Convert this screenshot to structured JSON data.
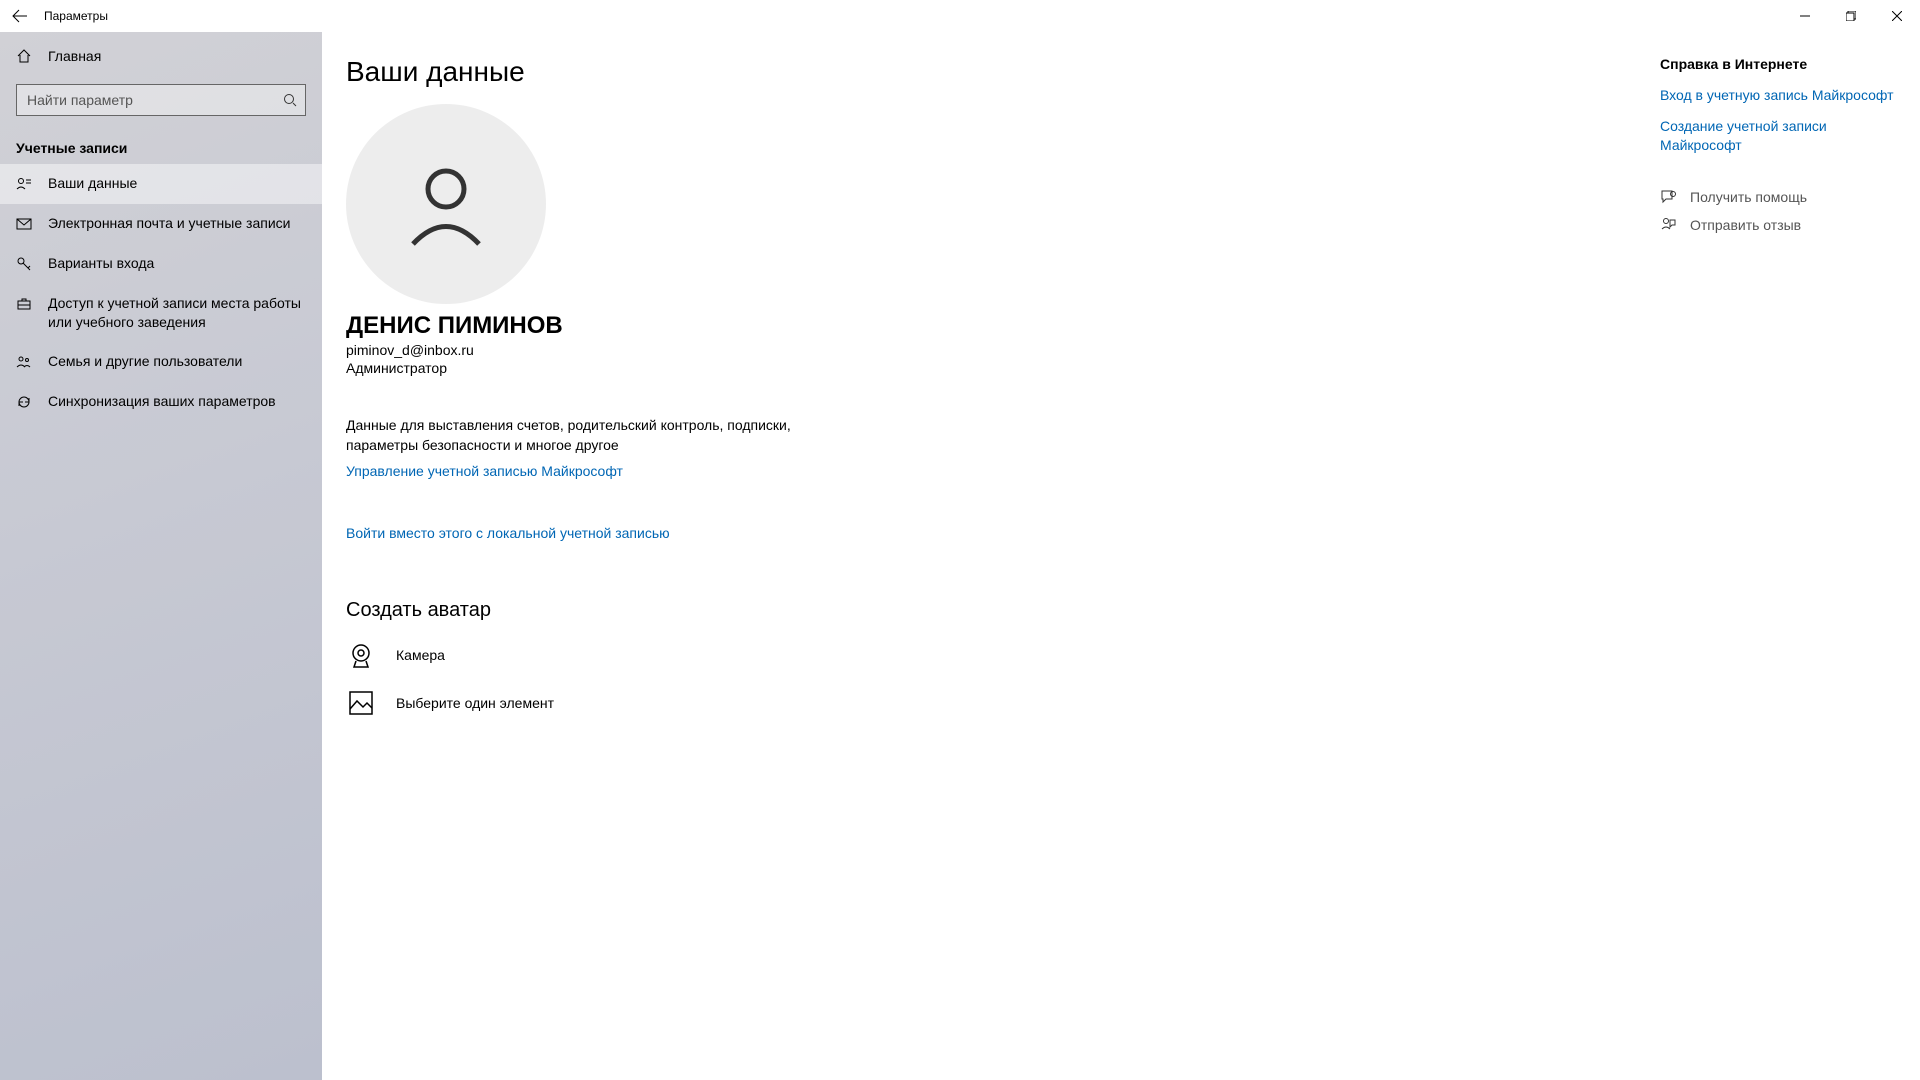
{
  "window": {
    "title": "Параметры"
  },
  "sidebar": {
    "home": "Главная",
    "search_placeholder": "Найти параметр",
    "section": "Учетные записи",
    "items": [
      {
        "label": "Ваши данные",
        "icon": "user-detail-icon",
        "active": true
      },
      {
        "label": "Электронная почта и учетные записи",
        "icon": "mail-icon"
      },
      {
        "label": "Варианты входа",
        "icon": "key-icon"
      },
      {
        "label": "Доступ к учетной записи места работы или учебного заведения",
        "icon": "briefcase-icon"
      },
      {
        "label": "Семья и другие пользователи",
        "icon": "people-icon"
      },
      {
        "label": "Синхронизация ваших параметров",
        "icon": "sync-icon"
      }
    ]
  },
  "main": {
    "page_title": "Ваши данные",
    "user_name": "ДЕНИС ПИМИНОВ",
    "user_email": "piminov_d@inbox.ru",
    "user_role": "Администратор",
    "billing_text": "Данные для выставления счетов, родительский контроль, подписки, параметры безопасности и многое другое",
    "manage_link": "Управление учетной записью Майкрософт",
    "local_link": "Войти вместо этого с локальной учетной записью",
    "create_avatar": "Создать аватар",
    "camera": "Камера",
    "browse": "Выберите один элемент"
  },
  "right": {
    "help_title": "Справка в Интернете",
    "links": [
      "Вход в учетную запись Майкрософт",
      "Создание учетной записи Майкрософт"
    ],
    "get_help": "Получить помощь",
    "feedback": "Отправить отзыв"
  }
}
